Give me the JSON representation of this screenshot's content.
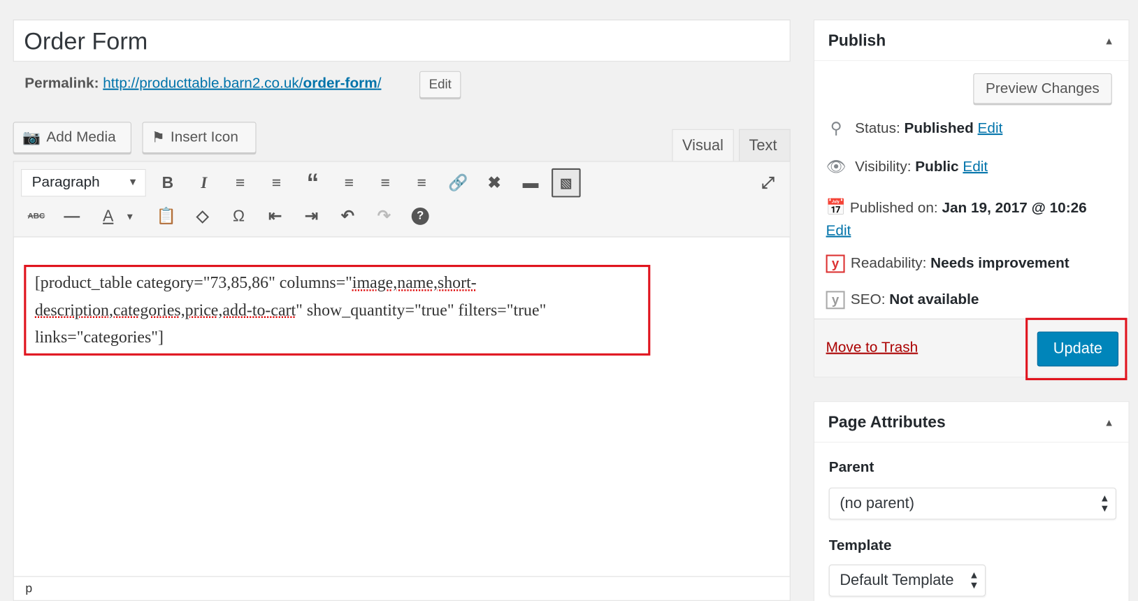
{
  "post": {
    "title": "Order Form",
    "permalink_label": "Permalink:",
    "permalink_base": "http://producttable.barn2.co.uk/",
    "permalink_slug": "order-form",
    "permalink_end": "/",
    "edit_label": "Edit"
  },
  "media": {
    "add_media": "Add Media",
    "insert_icon": "Insert Icon"
  },
  "tabs": {
    "visual": "Visual",
    "text": "Text",
    "active": "Visual"
  },
  "toolbar": {
    "format": "Paragraph",
    "row1": [
      "bold-icon",
      "italic-icon",
      "bullet-list-icon",
      "numbered-list-icon",
      "blockquote-icon",
      "align-left-icon",
      "align-center-icon",
      "align-right-icon",
      "link-icon",
      "unlink-icon",
      "read-more-icon",
      "toolbar-toggle-icon",
      "fullscreen-icon"
    ],
    "row2": [
      "strikethrough-icon",
      "horizontal-line-icon",
      "text-color-icon",
      "paste-text-icon",
      "clear-formatting-icon",
      "special-character-icon",
      "outdent-icon",
      "indent-icon",
      "undo-icon",
      "redo-icon",
      "help-icon"
    ]
  },
  "content": {
    "line1a": "[product_table category=\"73,85,86\" columns=\"",
    "line1b": "image,name,short-",
    "line2a": "description,categories,price,add-to-cart",
    "line2b": "\" show_quantity=\"true\" filters=\"true\"",
    "line3": "links=\"categories\"]"
  },
  "statusbar": {
    "path": "p"
  },
  "publish": {
    "title": "Publish",
    "preview": "Preview Changes",
    "status_label": "Status:",
    "status_value": "Published",
    "visibility_label": "Visibility:",
    "visibility_value": "Public",
    "published_label": "Published on:",
    "published_value": "Jan 19, 2017 @ 10:26",
    "edit": "Edit",
    "readability_label": "Readability:",
    "readability_value": "Needs improvement",
    "seo_label": "SEO:",
    "seo_value": "Not available",
    "trash": "Move to Trash",
    "update": "Update",
    "trash_color": "#a00",
    "update_color": "#0085ba"
  },
  "attributes": {
    "title": "Page Attributes",
    "parent_label": "Parent",
    "parent_value": "(no parent)",
    "template_label": "Template",
    "template_value": "Default Template"
  }
}
